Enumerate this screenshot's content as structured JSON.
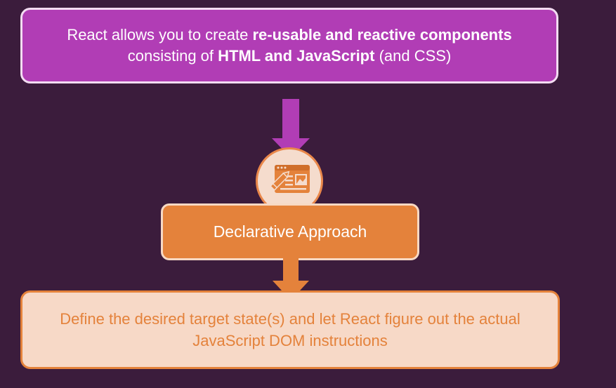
{
  "top_box": {
    "text_1": "React allows you to create ",
    "bold_1": "re-usable and reactive components",
    "text_2": " consisting of ",
    "bold_2": "HTML and JavaScript",
    "text_3": " (and CSS)"
  },
  "middle_box": {
    "label": "Declarative Approach",
    "icon": "web-page-edit-icon"
  },
  "bottom_box": {
    "text": "Define the desired target state(s) and let React figure out the actual JavaScript DOM instructions"
  },
  "colors": {
    "background": "#3b1c3c",
    "purple": "#b13db5",
    "orange": "#e4823b",
    "peach": "#f7d9c7"
  }
}
